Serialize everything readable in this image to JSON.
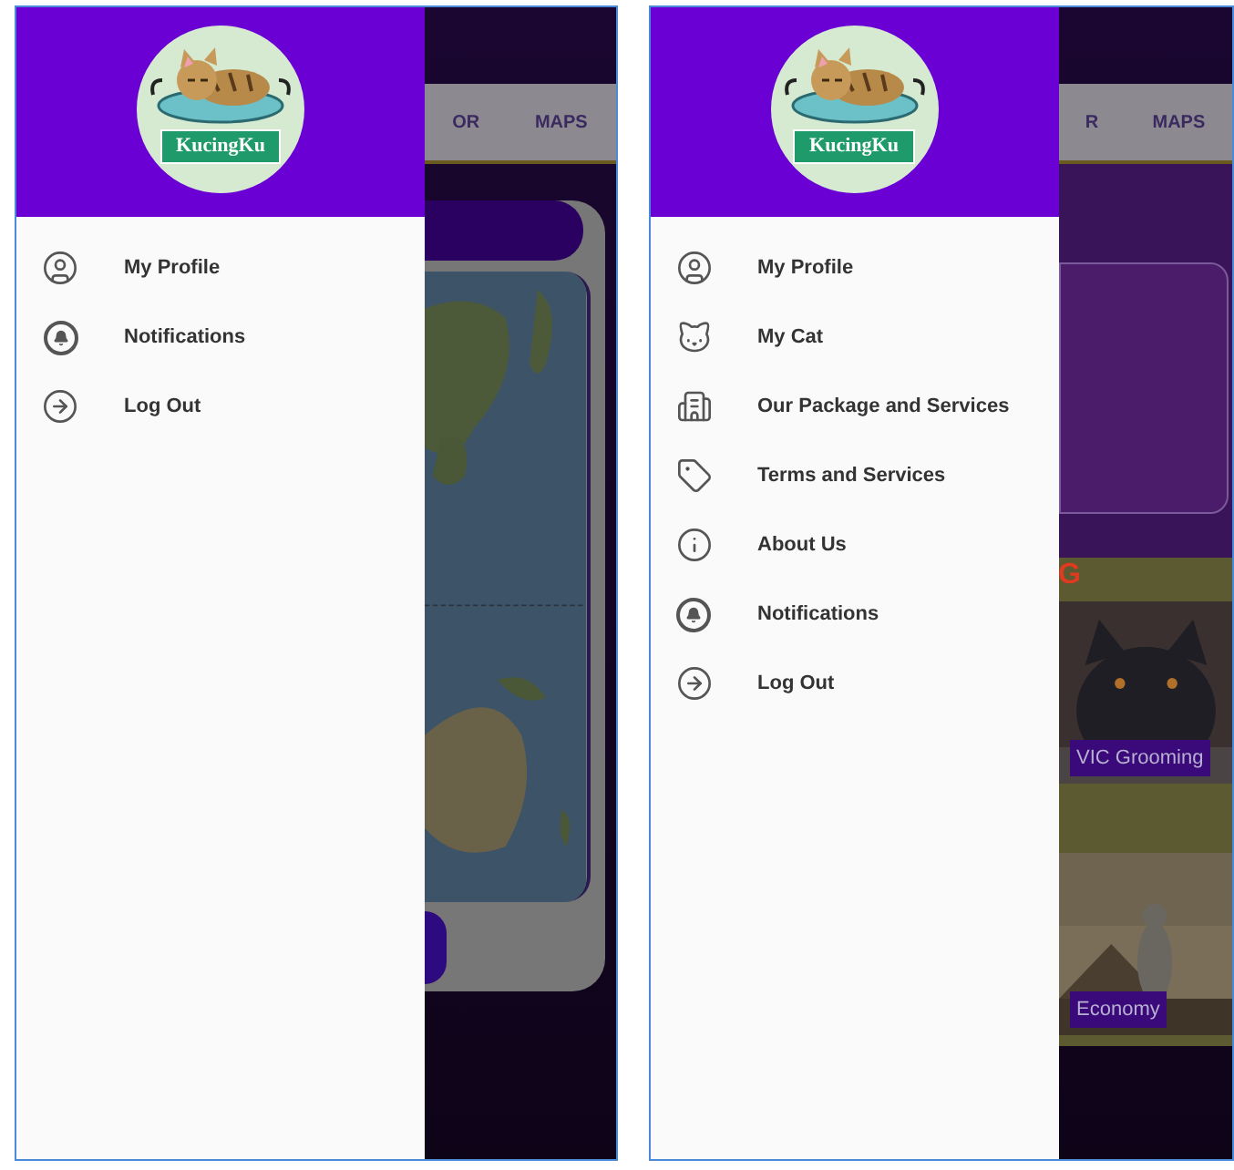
{
  "phones": [
    {
      "logo_text": "KucingKu",
      "menu": [
        {
          "kind": "profile",
          "label": "My Profile"
        },
        {
          "kind": "bell",
          "label": "Notifications"
        },
        {
          "kind": "logout",
          "label": "Log Out"
        }
      ],
      "behind": {
        "kind": "map",
        "tabs": [
          "OR",
          "MAPS"
        ]
      }
    },
    {
      "logo_text": "KucingKu",
      "menu": [
        {
          "kind": "profile",
          "label": "My Profile"
        },
        {
          "kind": "cat",
          "label": "My Cat"
        },
        {
          "kind": "building",
          "label": "Our Package and Services"
        },
        {
          "kind": "tag",
          "label": "Terms and Services"
        },
        {
          "kind": "info",
          "label": "About Us"
        },
        {
          "kind": "bell",
          "label": "Notifications"
        },
        {
          "kind": "logout",
          "label": "Log Out"
        }
      ],
      "behind": {
        "kind": "packages",
        "tabs": [
          "R",
          "MAPS"
        ],
        "heading": "G",
        "cards": [
          {
            "label": "VIC Grooming"
          },
          {
            "label": "Economy"
          }
        ]
      }
    }
  ]
}
